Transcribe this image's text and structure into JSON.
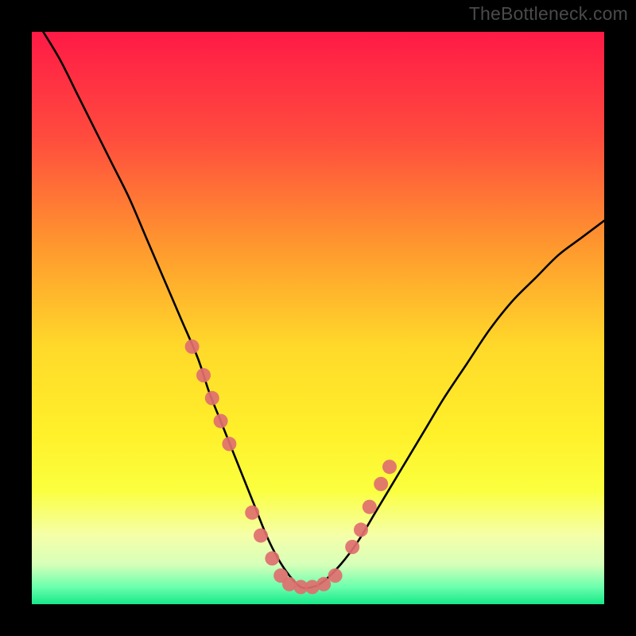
{
  "watermark": "TheBottleneck.com",
  "chart_data": {
    "type": "line",
    "title": "",
    "subtitle": "",
    "xlabel": "",
    "ylabel": "",
    "xlim": [
      0,
      100
    ],
    "ylim": [
      0,
      100
    ],
    "grid": false,
    "legend": false,
    "annotations": [],
    "background_gradient": {
      "type": "vertical",
      "description": "top-to-bottom gradient encoding bottleneck severity",
      "stops": [
        {
          "pos": 0.0,
          "color": "#ff1a46"
        },
        {
          "pos": 0.18,
          "color": "#ff4a3e"
        },
        {
          "pos": 0.38,
          "color": "#ff9a2e"
        },
        {
          "pos": 0.55,
          "color": "#ffd92a"
        },
        {
          "pos": 0.7,
          "color": "#fff02a"
        },
        {
          "pos": 0.8,
          "color": "#fbff3e"
        },
        {
          "pos": 0.88,
          "color": "#f5ffa9"
        },
        {
          "pos": 0.93,
          "color": "#d7ffb9"
        },
        {
          "pos": 0.97,
          "color": "#6bffad"
        },
        {
          "pos": 1.0,
          "color": "#17e88a"
        }
      ]
    },
    "series": [
      {
        "name": "bottleneck-curve",
        "type": "line",
        "color": "#000000",
        "x": [
          2,
          5,
          8,
          11,
          14,
          17,
          20,
          23,
          26,
          29,
          31,
          33,
          35,
          37,
          39,
          41,
          43,
          45,
          47,
          49,
          51,
          54,
          57,
          60,
          63,
          66,
          69,
          72,
          76,
          80,
          84,
          88,
          92,
          96,
          100
        ],
        "y": [
          100,
          95,
          89,
          83,
          77,
          71,
          64,
          57,
          50,
          43,
          37,
          32,
          27,
          22,
          17,
          12,
          8,
          5,
          3,
          3,
          4,
          7,
          11,
          16,
          21,
          26,
          31,
          36,
          42,
          48,
          53,
          57,
          61,
          64,
          67
        ]
      },
      {
        "name": "highlight-points",
        "type": "scatter",
        "color": "#df6f6f",
        "x": [
          28,
          30,
          31.5,
          33,
          34.5,
          38.5,
          40,
          42,
          43.5,
          45,
          47,
          49,
          51,
          53,
          56,
          57.5,
          59,
          61,
          62.5
        ],
        "y": [
          45,
          40,
          36,
          32,
          28,
          16,
          12,
          8,
          5,
          3.5,
          3,
          3,
          3.5,
          5,
          10,
          13,
          17,
          21,
          24
        ]
      }
    ]
  }
}
